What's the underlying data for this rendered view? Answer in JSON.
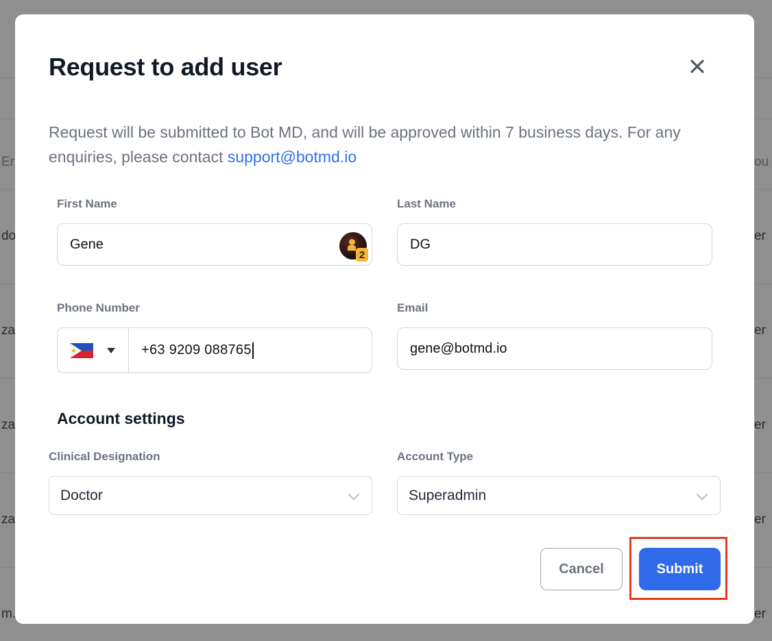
{
  "background": {
    "header_left": "Er",
    "header_right": "ou",
    "rows": [
      {
        "left": "do",
        "right": "er"
      },
      {
        "left": "za",
        "right": "er"
      },
      {
        "left": "za",
        "right": "er"
      },
      {
        "left": "za",
        "right": "er"
      },
      {
        "left": "m.",
        "right": "er"
      }
    ]
  },
  "modal": {
    "title": "Request to add user",
    "close_icon": "close-icon",
    "description": "Request will be submitted to Bot MD, and will be approved within 7 business days. For any enquiries, please contact",
    "support_email": "support@botmd.io"
  },
  "form": {
    "first_name": {
      "label": "First Name",
      "value": "Gene",
      "autofill_badge_count": "2"
    },
    "last_name": {
      "label": "Last Name",
      "value": "DG"
    },
    "phone": {
      "label": "Phone Number",
      "country_flag": "philippines-flag",
      "value": "+63 9209 088765"
    },
    "email": {
      "label": "Email",
      "value": "gene@botmd.io"
    }
  },
  "account_settings": {
    "section_title": "Account settings",
    "clinical_designation": {
      "label": "Clinical Designation",
      "value": "Doctor"
    },
    "account_type": {
      "label": "Account Type",
      "value": "Superadmin"
    }
  },
  "actions": {
    "cancel_label": "Cancel",
    "submit_label": "Submit",
    "highlighted": "submit-button"
  },
  "colors": {
    "primary": "#2f6ae9",
    "link": "#2f6ee8",
    "highlight": "#e53a1e",
    "overlay": "#8f8f8f"
  }
}
